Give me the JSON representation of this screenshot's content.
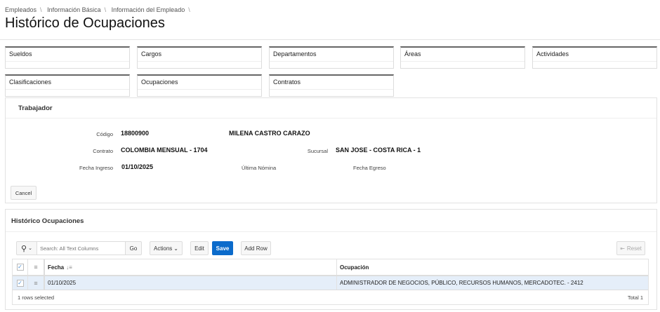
{
  "breadcrumb": [
    "Empleados",
    "Información Básica",
    "Información del Empleado"
  ],
  "page_title": "Histórico de Ocupaciones",
  "cards": [
    "Sueldos",
    "Cargos",
    "Departamentos",
    "Áreas",
    "Actividades",
    "Clasificaciones",
    "Ocupaciones",
    "Contratos"
  ],
  "trabajador": {
    "title": "Trabajador",
    "codigo_label": "Código",
    "codigo": "18800900",
    "nombre": "MILENA CASTRO CARAZO",
    "contrato_label": "Contrato",
    "contrato": "COLOMBIA MENSUAL - 1704",
    "sucursal_label": "Sucursal",
    "sucursal": "SAN JOSE - COSTA RICA - 1",
    "fecha_ingreso_label": "Fecha Ingreso",
    "fecha_ingreso": "01/10/2025",
    "ultima_nomina_label": "Última Nómina",
    "fecha_egreso_label": "Fecha Egreso",
    "cancel": "Cancel"
  },
  "historico": {
    "title": "Histórico Ocupaciones",
    "search_placeholder": "Search: All Text Columns",
    "go": "Go",
    "actions": "Actions",
    "edit": "Edit",
    "save": "Save",
    "add_row": "Add Row",
    "reset": "Reset",
    "columns": [
      "Fecha",
      "Ocupación"
    ],
    "rows": [
      {
        "fecha": "01/10/2025",
        "ocupacion": "ADMINISTRADOR DE NEGOCIOS, PÚBLICO, RECURSOS HUMANOS, MERCADOTEC. - 2412"
      }
    ],
    "selected": "1 rows selected",
    "total": "Total 1"
  },
  "colors": {
    "accent": "#0b6bcb",
    "row_selected": "#e5eef9"
  }
}
